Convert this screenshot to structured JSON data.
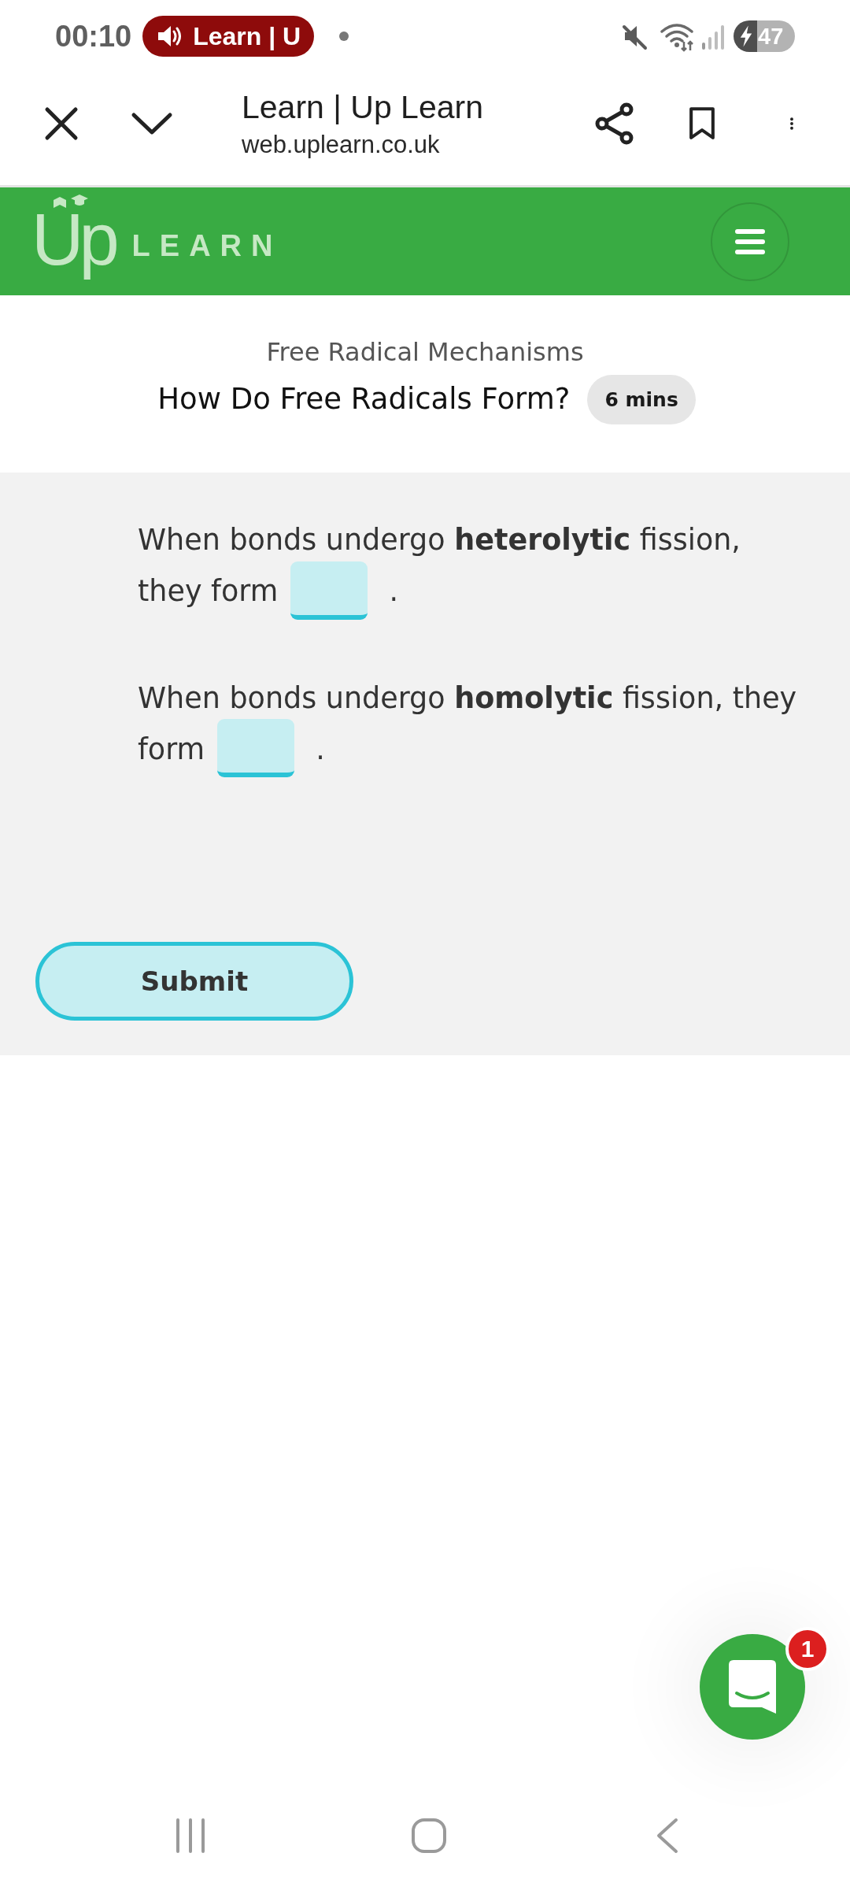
{
  "status_bar": {
    "time": "00:10",
    "media_chip": "Learn | U",
    "battery": "47"
  },
  "browser_bar": {
    "title": "Learn | Up Learn",
    "url": "web.uplearn.co.uk"
  },
  "site_header": {
    "logo_mark": "Up",
    "logo_word": "LEARN"
  },
  "lesson": {
    "topic": "Free Radical Mechanisms",
    "title": "How Do Free Radicals Form?",
    "duration": "6 mins"
  },
  "questions": [
    {
      "before": "When bonds undergo **heterolytic** fission, they form",
      "after": "."
    },
    {
      "before": "When bonds undergo **homolytic** fission, they form",
      "after": "."
    }
  ],
  "submit": {
    "label": "Submit"
  },
  "chat": {
    "badge": "1"
  }
}
